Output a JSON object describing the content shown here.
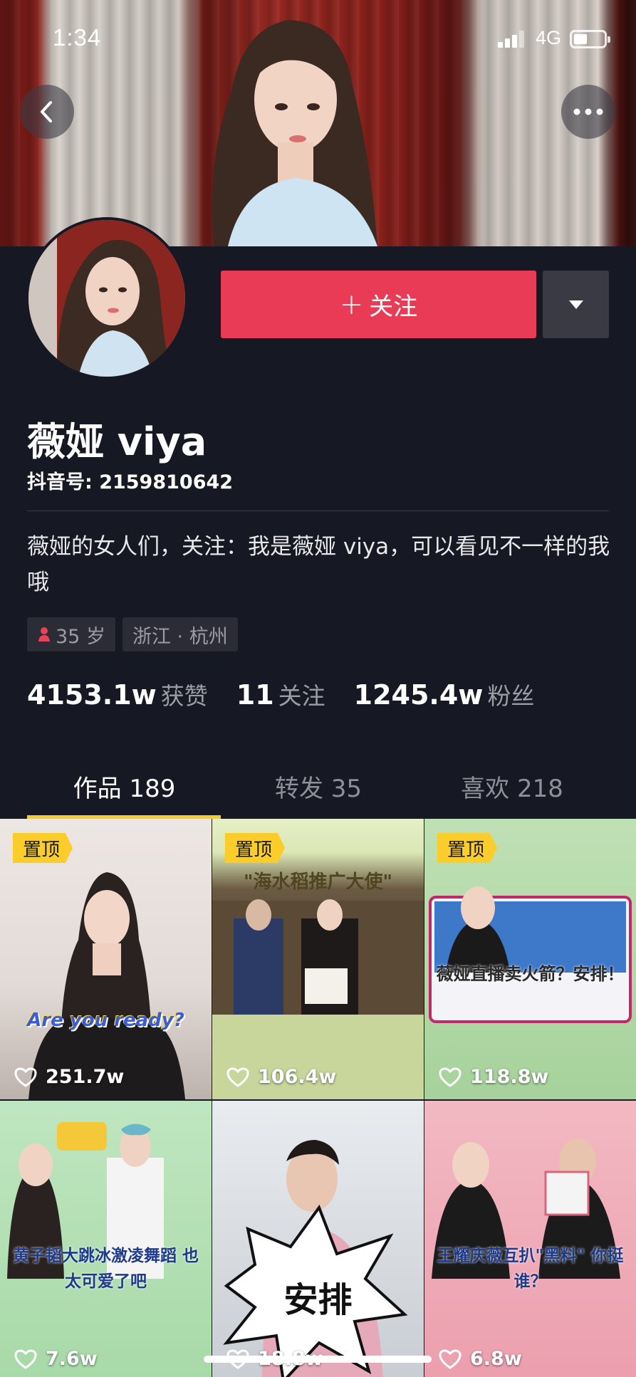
{
  "status_bar": {
    "time": "1:34",
    "network": "4G"
  },
  "header": {
    "back_icon": "chevron-left-icon",
    "more_icon": "ellipsis-icon"
  },
  "profile": {
    "follow_label": "+ 关注",
    "follow_text": "关注",
    "name": "薇娅 viya",
    "douyin_id": "抖音号: 2159810642",
    "bio": "薇娅的女人们，关注：我是薇娅 viya，可以看见不一样的我哦",
    "tags": {
      "age": "35 岁",
      "location": "浙江 · 杭州"
    },
    "stats": [
      {
        "num": "4153.1w",
        "label": "获赞"
      },
      {
        "num": "11",
        "label": "关注"
      },
      {
        "num": "1245.4w",
        "label": "粉丝"
      }
    ]
  },
  "tabs": [
    {
      "label": "作品 189"
    },
    {
      "label": "转发 35"
    },
    {
      "label": "喜欢 218"
    }
  ],
  "videos": [
    {
      "pinned": "置顶",
      "likes": "251.7w",
      "caption": "Are you ready?"
    },
    {
      "pinned": "置顶",
      "likes": "106.4w",
      "caption": "\"海水稻推广大使\""
    },
    {
      "pinned": "置顶",
      "likes": "118.8w",
      "caption": "薇娅直播卖火箭？安排！"
    },
    {
      "pinned": "",
      "likes": "7.6w",
      "caption": "黄子韬大跳冰激凌舞蹈 也太可爱了吧"
    },
    {
      "pinned": "",
      "likes": "18.8w",
      "caption": "安排"
    },
    {
      "pinned": "",
      "likes": "6.8w",
      "caption": "王耀庆薇互扒\"黑料\" 你挺谁？"
    }
  ],
  "colors": {
    "background": "#161823",
    "follow": "#ea3b56",
    "tab_underline": "#f6cb2e",
    "pin": "#facd2a"
  }
}
